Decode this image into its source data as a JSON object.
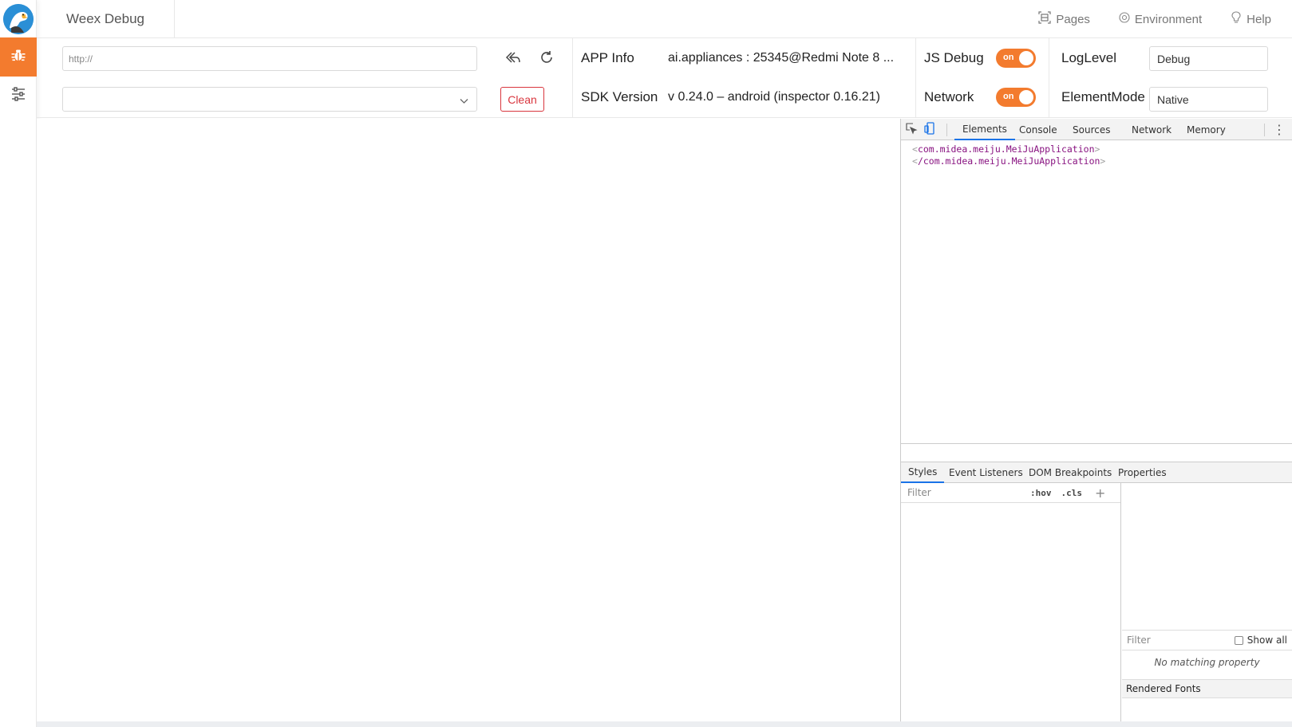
{
  "header": {
    "brand": "Weex Debug",
    "menu": [
      {
        "icon": "pages-icon",
        "label": "Pages"
      },
      {
        "icon": "environment-icon",
        "label": "Environment"
      },
      {
        "icon": "help-icon",
        "label": "Help"
      }
    ]
  },
  "rail": {
    "items": [
      {
        "icon": "bug-icon",
        "active": true
      },
      {
        "icon": "sliders-icon",
        "active": false
      }
    ],
    "accent": "#f37b2e"
  },
  "toolbar": {
    "url_placeholder": "http://",
    "url_value": "",
    "select_value": "",
    "clean_label": "Clean",
    "app_info_label": "APP Info",
    "app_info_value": "ai.appliances : 25345@Redmi Note 8 ...",
    "sdk_label": "SDK Version",
    "sdk_value": "v 0.24.0 – android (inspector 0.16.21)",
    "js_debug_label": "JS Debug",
    "js_debug_toggle": "on",
    "network_label": "Network",
    "network_toggle": "on",
    "loglevel_label": "LogLevel",
    "loglevel_value": "Debug",
    "elementmode_label": "ElementMode",
    "elementmode_value": "Native"
  },
  "devtools": {
    "tabs": [
      "Elements",
      "Console",
      "Sources",
      "Network",
      "Memory"
    ],
    "active_tab": "Elements",
    "dom": {
      "open_tag": "com.midea.meiju.MeiJuApplication",
      "close_tag": "/com.midea.meiju.MeiJuApplication"
    },
    "styles_tabs": [
      "Styles",
      "Event Listeners",
      "DOM Breakpoints",
      "Properties"
    ],
    "styles_filter_placeholder": "Filter",
    "hov": ":hov",
    "cls": ".cls",
    "computed_filter_placeholder": "Filter",
    "show_all": "Show all",
    "no_match": "No matching property",
    "rendered_fonts": "Rendered Fonts",
    "accent": "#1a73e8"
  }
}
